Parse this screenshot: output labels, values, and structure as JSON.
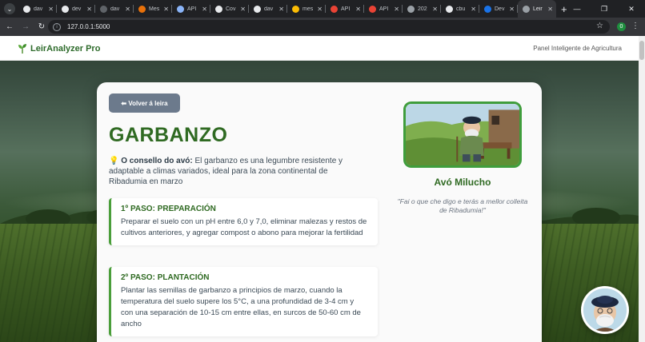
{
  "browser": {
    "tabs": [
      {
        "title": "dav",
        "favicon": "github-icon",
        "color": "#e8eaed"
      },
      {
        "title": "dev",
        "favicon": "github-icon",
        "color": "#e8eaed"
      },
      {
        "title": "dav",
        "favicon": "blank-icon",
        "color": "#5f6368"
      },
      {
        "title": "Mes",
        "favicon": "globe-icon",
        "color": "#e8710a"
      },
      {
        "title": "API",
        "favicon": "doc-icon",
        "color": "#8ab4f8"
      },
      {
        "title": "Cov",
        "favicon": "github-icon",
        "color": "#e8eaed"
      },
      {
        "title": "dav",
        "favicon": "github-icon",
        "color": "#e8eaed"
      },
      {
        "title": "mes",
        "favicon": "app-icon",
        "color": "#fbbc04"
      },
      {
        "title": "API",
        "favicon": "gemini-icon",
        "color": "#ea4335"
      },
      {
        "title": "API",
        "favicon": "gemini-icon",
        "color": "#ea4335"
      },
      {
        "title": "202",
        "favicon": "globe-icon",
        "color": "#9aa0a6"
      },
      {
        "title": "cbu",
        "favicon": "github-icon",
        "color": "#e8eaed"
      },
      {
        "title": "Dev",
        "favicon": "d-icon",
        "color": "#1a73e8"
      },
      {
        "title": "Leir",
        "favicon": "globe-icon",
        "color": "#9aa0a6",
        "active": true
      }
    ],
    "url": "127.0.0.1:5000",
    "extension_badge": "0"
  },
  "navbar": {
    "brand": "LeirAnalyzer Pro",
    "tagline": "Panel Inteligente de Agricultura"
  },
  "card": {
    "back_button": "⬅ Volver á leira",
    "crop_title": "GARBANZO",
    "advice_icon": "💡",
    "advice_label": "O consello do avó:",
    "advice_text": "El garbanzo es una legumbre resistente y adaptable a climas variados, ideal para la zona continental de Ribadumia en marzo",
    "steps": [
      {
        "title": "1º PASO: PREPARACIÓN",
        "text": "Preparar el suelo con un pH entre 6,0 y 7,0, eliminar malezas y restos de cultivos anteriores, y agregar compost o abono para mejorar la fertilidad"
      },
      {
        "title": "2º PASO: PLANTACIÓN",
        "text": "Plantar las semillas de garbanzo a principios de marzo, cuando la temperatura del suelo supere los 5°C, a una profundidad de 3-4 cm y con una separación de 10-15 cm entre ellas, en surcos de 50-60 cm de ancho"
      }
    ],
    "grandpa_name": "Avó Milucho",
    "grandpa_quote": "\"Fai o que che digo e terás a mellor colleita de Ribadumia!\""
  },
  "colors": {
    "accent": "#2f6a22",
    "step_border": "#4a9e3a",
    "back_button": "#6c7a8c"
  }
}
